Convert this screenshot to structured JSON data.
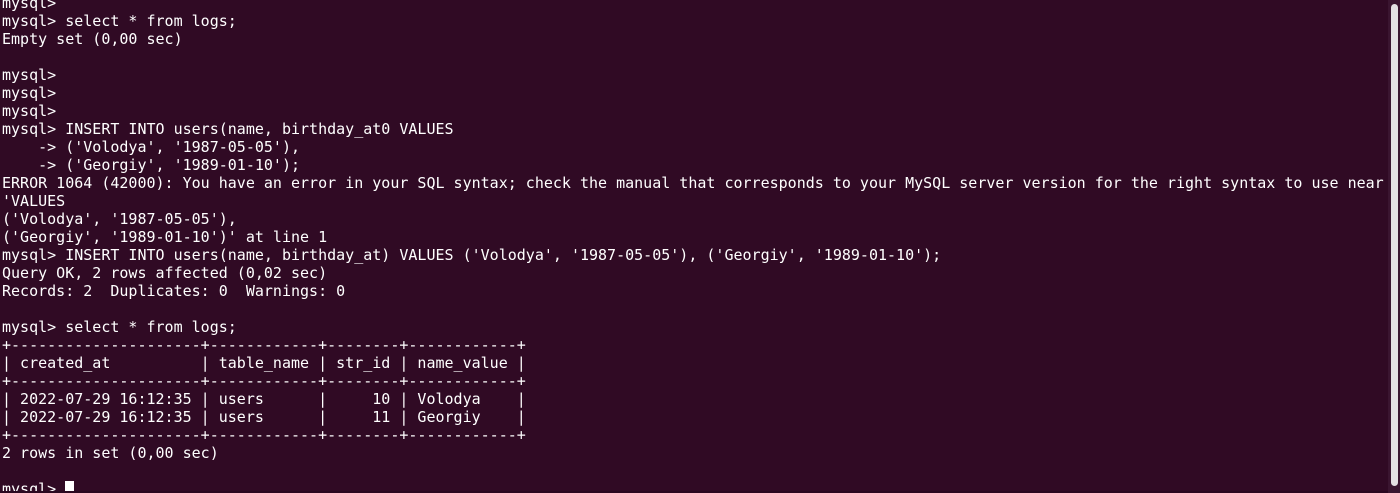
{
  "terminal": {
    "lines": [
      "mysql>",
      "mysql> select * from logs;",
      "Empty set (0,00 sec)",
      "",
      "mysql>",
      "mysql>",
      "mysql>",
      "mysql> INSERT INTO users(name, birthday_at0 VALUES",
      "    -> ('Volodya', '1987-05-05'),",
      "    -> ('Georgiy', '1989-01-10');",
      "ERROR 1064 (42000): You have an error in your SQL syntax; check the manual that corresponds to your MySQL server version for the right syntax to use near",
      "'VALUES",
      "('Volodya', '1987-05-05'),",
      "('Georgiy', '1989-01-10')' at line 1",
      "mysql> INSERT INTO users(name, birthday_at) VALUES ('Volodya', '1987-05-05'), ('Georgiy', '1989-01-10');",
      "Query OK, 2 rows affected (0,02 sec)",
      "Records: 2  Duplicates: 0  Warnings: 0",
      "",
      "mysql> select * from logs;",
      "+---------------------+------------+--------+------------+",
      "| created_at          | table_name | str_id | name_value |",
      "+---------------------+------------+--------+------------+",
      "| 2022-07-29 16:12:35 | users      |     10 | Volodya    |",
      "| 2022-07-29 16:12:35 | users      |     11 | Georgiy    |",
      "+---------------------+------------+--------+------------+",
      "2 rows in set (0,00 sec)",
      ""
    ],
    "prompt": "mysql> ",
    "colors": {
      "background": "#300a24",
      "foreground": "#ffffff"
    }
  }
}
